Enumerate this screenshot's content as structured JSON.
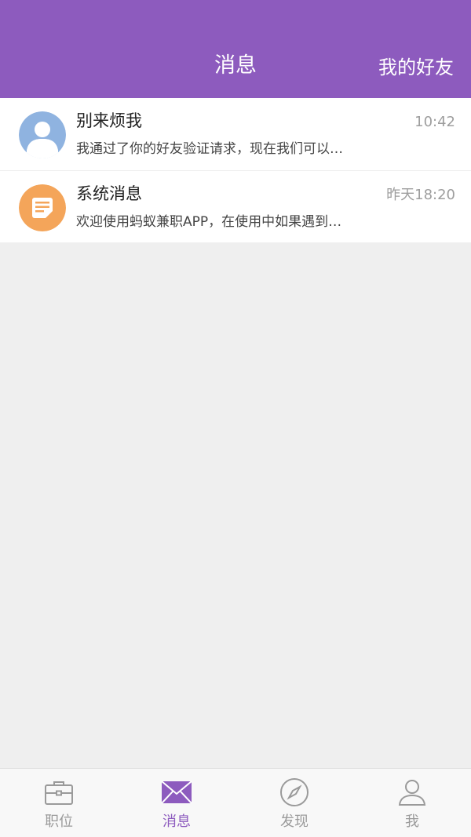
{
  "header": {
    "title": "消息",
    "friends_label": "我的好友"
  },
  "conversations": [
    {
      "name": "别来烦我",
      "time": "10:42",
      "preview": "我通过了你的好友验证请求，现在我们可以…",
      "icon": "user-avatar-icon",
      "avatar_color": "#8fb3e0"
    },
    {
      "name": "系统消息",
      "time": "昨天18:20",
      "preview": "欢迎使用蚂蚁兼职APP，在使用中如果遇到…",
      "icon": "system-notice-icon",
      "avatar_color": "#f4a55a"
    }
  ],
  "tabbar": {
    "tabs": [
      {
        "label": "职位",
        "icon": "briefcase-icon",
        "active": false
      },
      {
        "label": "消息",
        "icon": "envelope-icon",
        "active": true
      },
      {
        "label": "发现",
        "icon": "compass-icon",
        "active": false
      },
      {
        "label": "我",
        "icon": "person-icon",
        "active": false
      }
    ]
  },
  "colors": {
    "accent": "#8d5bbe",
    "inactive": "#9a9a9a",
    "background": "#efefef"
  }
}
